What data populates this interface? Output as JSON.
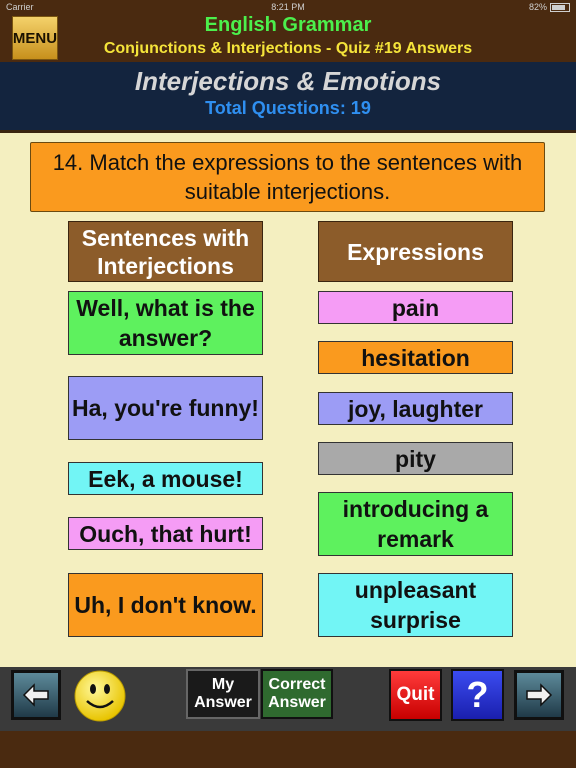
{
  "status_bar": {
    "carrier": "Carrier",
    "time": "8:21 PM",
    "battery": "82%"
  },
  "header": {
    "menu_label": "MENU",
    "app_title": "English Grammar",
    "quiz_title": "Conjunctions & Interjections - Quiz #19 Answers"
  },
  "topic": {
    "title": "Interjections & Emotions",
    "total_questions": "Total Questions: 19"
  },
  "question": {
    "text": "14. Match the expressions to the sentences with suitable interjections."
  },
  "columns": {
    "left_header": "Sentences with Interjections",
    "right_header": "Expressions"
  },
  "sentences": [
    {
      "text": "Well, what is the answer?",
      "color": "#5ef15e"
    },
    {
      "text": "Ha, you're funny!",
      "color": "#9c9cf5"
    },
    {
      "text": "Eek, a mouse!",
      "color": "#72f5f5"
    },
    {
      "text": "Ouch, that hurt!",
      "color": "#f59cf5"
    },
    {
      "text": "Uh, I don't know.",
      "color": "#fa9a1e"
    }
  ],
  "expressions": [
    {
      "text": "pain",
      "color": "#f59cf5"
    },
    {
      "text": "hesitation",
      "color": "#fa9a1e"
    },
    {
      "text": "joy, laughter",
      "color": "#9c9cf5"
    },
    {
      "text": "pity",
      "color": "#a9a9a9"
    },
    {
      "text": "introducing a remark",
      "color": "#5ef15e"
    },
    {
      "text": "unpleasant surprise",
      "color": "#72f5f5"
    }
  ],
  "toolbar": {
    "prev_icon": "arrow-left-icon",
    "smiley_icon": "smiley-face-icon",
    "my_answer_label": "My Answer",
    "correct_answer_label": "Correct Answer",
    "quit_label": "Quit",
    "help_label": "?",
    "next_icon": "arrow-right-icon"
  }
}
